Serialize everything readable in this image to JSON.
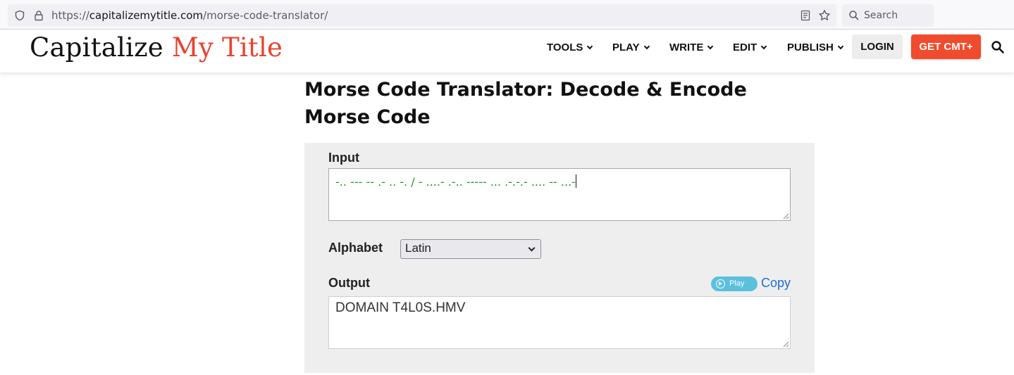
{
  "browser": {
    "url_prefix": "https://",
    "url_host": "capitalizemytitle.com",
    "url_path": "/morse-code-translator/",
    "search_placeholder": "Search"
  },
  "header": {
    "logo_main": "Capitalize",
    "logo_accent": "My Title",
    "nav": [
      {
        "label": "TOOLS"
      },
      {
        "label": "PLAY"
      },
      {
        "label": "WRITE"
      },
      {
        "label": "EDIT"
      },
      {
        "label": "PUBLISH"
      }
    ],
    "login_label": "LOGIN",
    "cta_label": "GET CMT+"
  },
  "main": {
    "title": "Morse Code Translator: Decode & Encode Morse Code",
    "input_label": "Input",
    "input_value": "-.. --- -- .- .. -. / - ....- .-.. ----- ... .-.-.- .... -- ...-",
    "alphabet_label": "Alphabet",
    "alphabet_selected": "Latin",
    "output_label": "Output",
    "play_label": "Play",
    "copy_label": "Copy",
    "output_value": "DOMAIN T4L0S.HMV"
  },
  "colors": {
    "accent": "#e8422f",
    "cta": "#f04b2c",
    "input_text": "#1c9a1c",
    "play": "#5bc0de",
    "copy": "#1a6fd6"
  }
}
